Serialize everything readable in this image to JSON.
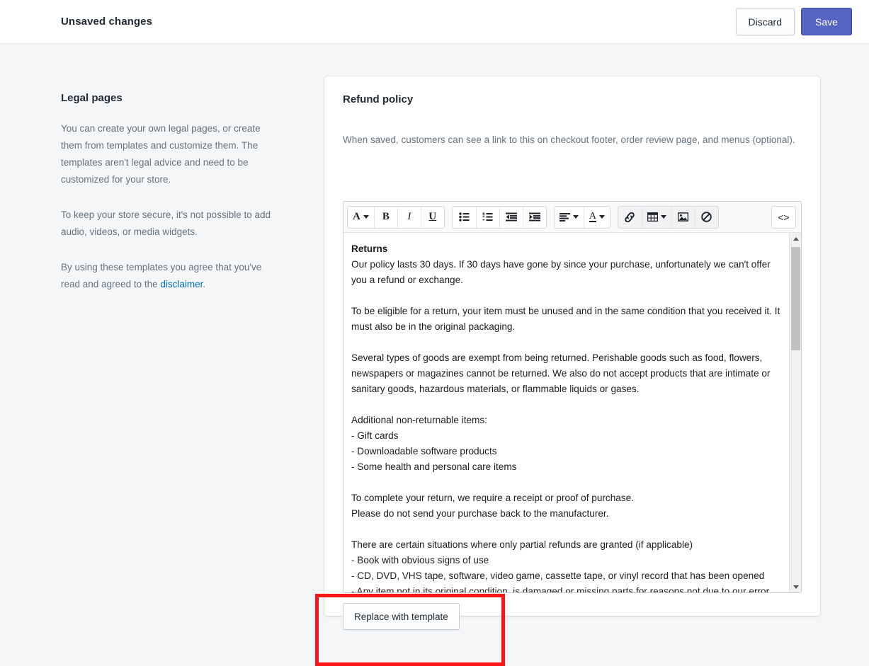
{
  "savebar": {
    "title": "Unsaved changes",
    "discard_label": "Discard",
    "save_label": "Save",
    "save_color": "#5563c1"
  },
  "sidebar": {
    "heading": "Legal pages",
    "paragraph_1": "You can create your own legal pages, or create them from templates and customize them. The templates aren't legal advice and need to be customized for your store.",
    "paragraph_2": "To keep your store secure, it's not possible to add audio, videos, or media widgets.",
    "paragraph_3_prefix": "By using these templates you agree that you've read and agreed to the ",
    "disclaimer_link": "disclaimer",
    "paragraph_3_suffix": ".",
    "link_color": "#006fbb"
  },
  "card": {
    "title": "Refund policy",
    "subtitle": "When saved, customers can see a link to this on checkout footer, order review page, and menus (optional).",
    "replace_button_label": "Replace with template"
  },
  "toolbar": {
    "groups": [
      {
        "shaded": false,
        "buttons": [
          {
            "name": "font-style-dropdown",
            "glyph": "A",
            "caret": true
          },
          {
            "name": "bold-button",
            "glyph": "B",
            "caret": false
          },
          {
            "name": "italic-button",
            "glyph": "I",
            "caret": false
          },
          {
            "name": "underline-button",
            "glyph": "U",
            "caret": false
          }
        ]
      },
      {
        "shaded": false,
        "buttons": [
          {
            "name": "bulleted-list-button",
            "glyph": "",
            "caret": false
          },
          {
            "name": "numbered-list-button",
            "glyph": "",
            "caret": false
          },
          {
            "name": "outdent-button",
            "glyph": "",
            "caret": false
          },
          {
            "name": "indent-button",
            "glyph": "",
            "caret": false
          }
        ]
      },
      {
        "shaded": false,
        "buttons": [
          {
            "name": "align-dropdown",
            "glyph": "",
            "caret": true
          },
          {
            "name": "text-color-dropdown",
            "glyph": "A",
            "caret": true
          }
        ]
      },
      {
        "shaded": true,
        "buttons": [
          {
            "name": "insert-link-button",
            "glyph": "",
            "caret": false
          },
          {
            "name": "insert-table-dropdown",
            "glyph": "",
            "caret": true
          },
          {
            "name": "insert-image-button",
            "glyph": "",
            "caret": false
          },
          {
            "name": "clear-formatting-button",
            "glyph": "",
            "caret": false
          }
        ]
      },
      {
        "shaded": false,
        "buttons": [
          {
            "name": "code-view-button",
            "glyph": "<>",
            "caret": false
          }
        ]
      }
    ]
  },
  "editor": {
    "lines": [
      {
        "text": "Returns",
        "heading": true
      },
      {
        "text": "Our policy lasts 30 days. If 30 days have gone by since your purchase, unfortunately we can't offer you a refund or exchange.",
        "heading": false
      },
      {
        "text": "",
        "heading": false
      },
      {
        "text": "To be eligible for a return, your item must be unused and in the same condition that you received it. It must also be in the original packaging.",
        "heading": false
      },
      {
        "text": "",
        "heading": false
      },
      {
        "text": "Several types of goods are exempt from being returned. Perishable goods such as food, flowers, newspapers or magazines cannot be returned. We also do not accept products that are intimate or sanitary goods, hazardous materials, or flammable liquids or gases.",
        "heading": false
      },
      {
        "text": "",
        "heading": false
      },
      {
        "text": "Additional non-returnable items:",
        "heading": false
      },
      {
        "text": "- Gift cards",
        "heading": false
      },
      {
        "text": "- Downloadable software products",
        "heading": false
      },
      {
        "text": "- Some health and personal care items",
        "heading": false
      },
      {
        "text": "",
        "heading": false
      },
      {
        "text": "To complete your return, we require a receipt or proof of purchase.",
        "heading": false
      },
      {
        "text": "Please do not send your purchase back to the manufacturer.",
        "heading": false
      },
      {
        "text": "",
        "heading": false
      },
      {
        "text": "There are certain situations where only partial refunds are granted (if applicable)",
        "heading": false
      },
      {
        "text": "- Book with obvious signs of use",
        "heading": false
      },
      {
        "text": "- CD, DVD, VHS tape, software, video game, cassette tape, or vinyl record that has been opened",
        "heading": false
      },
      {
        "text": "- Any item not in its original condition, is damaged or missing parts for reasons not due to our error",
        "heading": false
      }
    ]
  },
  "annotation": {
    "color": "#fa1616"
  }
}
